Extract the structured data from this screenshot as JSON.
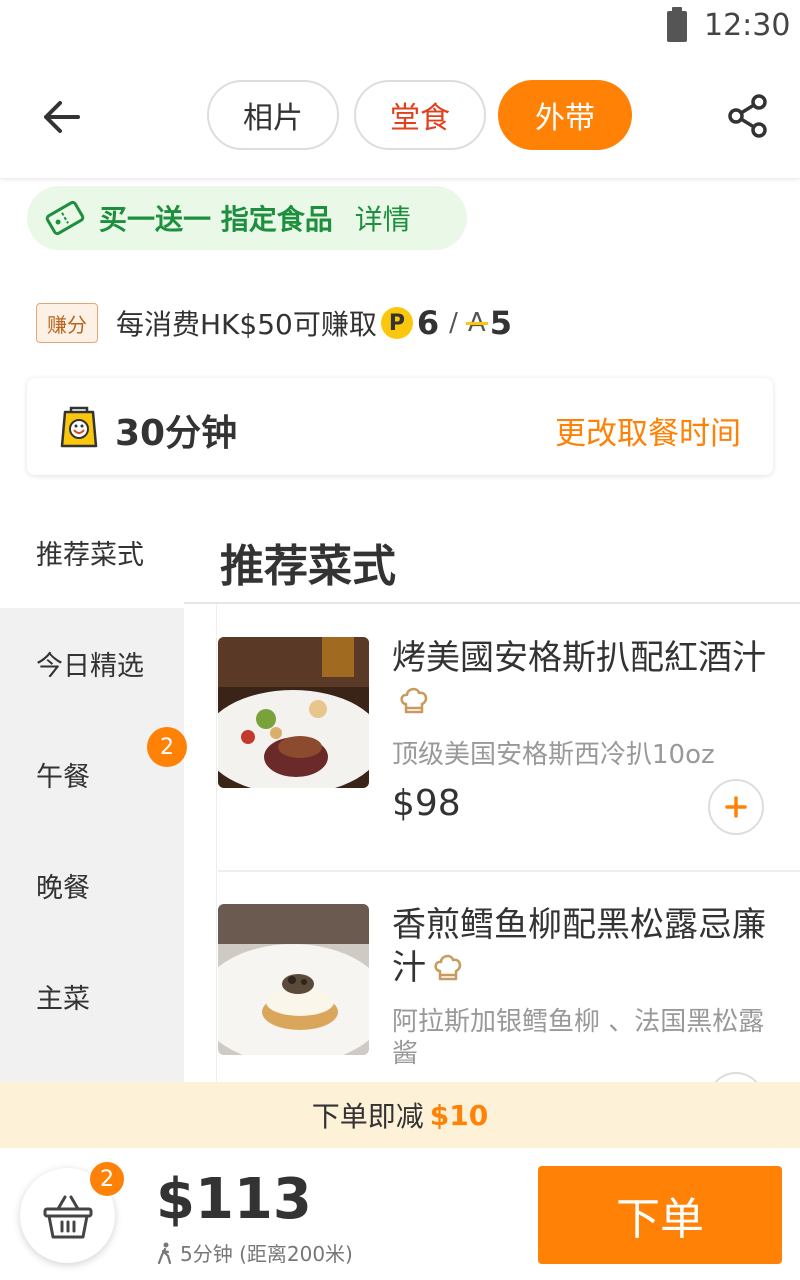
{
  "status_bar": {
    "time": "12:30"
  },
  "header": {
    "tabs": [
      {
        "label": "相片"
      },
      {
        "label": "堂食"
      },
      {
        "label": "外带"
      }
    ],
    "active_tab": "外带"
  },
  "promo": {
    "text": "买一送一 指定食品",
    "link": "详情"
  },
  "earn": {
    "badge": "赚分",
    "text": "每消费HK$50可赚取",
    "p_letter": "P",
    "p_points": "6",
    "separator": "/",
    "a_letter": "A",
    "a_points": "5"
  },
  "pickup": {
    "time": "30分钟",
    "change_label": "更改取餐时间"
  },
  "sidebar": {
    "items": [
      {
        "label": "推荐菜式"
      },
      {
        "label": "今日精选"
      },
      {
        "label": "午餐"
      },
      {
        "label": "晚餐"
      },
      {
        "label": "主菜"
      }
    ],
    "badge": "2"
  },
  "section": {
    "title": "推荐菜式"
  },
  "dishes": [
    {
      "name": "烤美國安格斯扒配紅酒汁",
      "desc": "顶级美国安格斯西冷扒10oz",
      "price": "$98"
    },
    {
      "name": "香煎鳕鱼柳配黑松露忌廉汁",
      "desc": "阿拉斯加银鳕鱼柳 、法国黑松露酱",
      "price": ""
    }
  ],
  "discount": {
    "text": "下单即减",
    "amount": "$10"
  },
  "cart": {
    "count": "2",
    "total": "$113",
    "eta": "5分钟 (距离200米)"
  },
  "order_button": {
    "label": "下单"
  },
  "colors": {
    "accent": "#ff8207",
    "dinein": "#e2401c",
    "promo_green": "#1e8f3e",
    "coin": "#fbc70c"
  },
  "icons": [
    "back-arrow-icon",
    "share-icon",
    "coupon-icon",
    "bag-icon",
    "chef-hat-icon",
    "plus-icon",
    "basket-icon",
    "walking-icon"
  ]
}
